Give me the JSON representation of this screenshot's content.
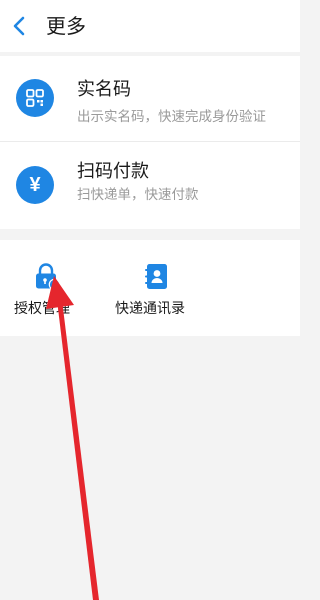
{
  "header": {
    "back_icon": "chevron-left-icon",
    "title": "更多"
  },
  "colors": {
    "accent": "#1f86e3",
    "annotation_arrow": "#e5262d",
    "background": "#f3f3f3",
    "card": "#ffffff",
    "secondary_text": "#9a9a9a"
  },
  "list": {
    "items": [
      {
        "icon": "qr-code-icon",
        "title": "实名码",
        "description": "出示实名码，快速完成身份验证"
      },
      {
        "icon": "yen-icon",
        "icon_glyph": "¥",
        "title": "扫码付款",
        "description": "扫快递单，快速付款"
      }
    ]
  },
  "grid": {
    "items": [
      {
        "icon": "lock-gear-icon",
        "label": "授权管理"
      },
      {
        "icon": "contacts-book-icon",
        "label": "快递通讯录"
      }
    ]
  }
}
